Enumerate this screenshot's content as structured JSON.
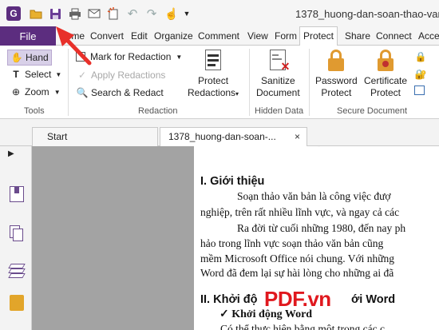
{
  "titlebar": {
    "doc_title": "1378_huong-dan-soan-thao-van-",
    "app_logo_letter": "G"
  },
  "menubar": {
    "file": "File",
    "tabs": [
      "Home",
      "Convert",
      "Edit",
      "Organize",
      "Comment",
      "View",
      "Form",
      "Protect",
      "Share",
      "Connect",
      "Acce"
    ],
    "active_tab": "Protect"
  },
  "ribbon": {
    "tools": {
      "hand": "Hand",
      "select": "Select",
      "zoom": "Zoom",
      "group_label": "Tools"
    },
    "redaction": {
      "mark": "Mark for Redaction",
      "apply": "Apply Redactions",
      "search": "Search & Redact",
      "protect_label_1": "Protect",
      "protect_label_2": "Redactions",
      "group_label": "Redaction"
    },
    "hidden_data": {
      "sanitize_1": "Sanitize",
      "sanitize_2": "Document",
      "group_label": "Hidden Data"
    },
    "secure": {
      "password_1": "Password",
      "password_2": "Protect",
      "certificate_1": "Certificate",
      "certificate_2": "Protect",
      "group_label": "Secure Document"
    }
  },
  "tabs": {
    "start": "Start",
    "doc": "1378_huong-dan-soan-...",
    "close": "×"
  },
  "document": {
    "heading1": "I. Giới thiệu",
    "lines": [
      "Soạn thảo văn bản là công việc đượ",
      "nghiệp, trên rất nhiều lĩnh vực, và ngay cả các",
      "Ra đời từ cuối những 1980, đến nay ph",
      "hảo trong lĩnh vực soạn thảo văn bản cũng",
      "mềm Microsoft Office nói chung. Với những",
      "Word đã đem lại sự hài lòng cho những ai đã"
    ],
    "heading2_a": "II. Khởi độ",
    "heading2_b": "ới Word",
    "sub1": "✓ Khởi động Word",
    "cut_line": "Có thể thực hiện bằng một trong các c"
  },
  "watermark": "PDF.vn",
  "colors": {
    "accent": "#5c2d7f",
    "arrow": "#e8302a",
    "doc_bg": "#a3a3a3"
  },
  "icons": {
    "open": "folder-icon",
    "save": "save-icon",
    "print": "printer-icon",
    "email": "email-icon",
    "new": "new-document-icon",
    "undo": "undo-icon",
    "redo": "redo-icon",
    "hand": "hand-icon"
  }
}
